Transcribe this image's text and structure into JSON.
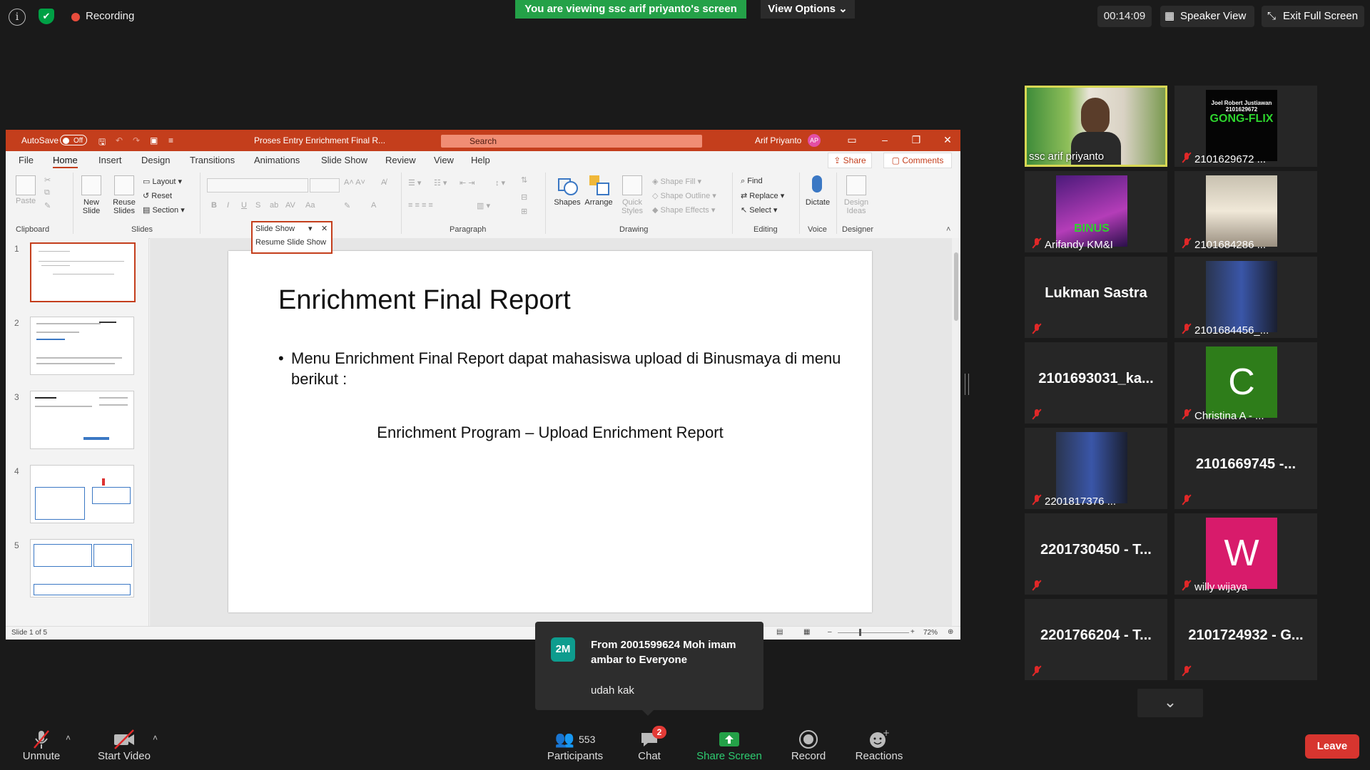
{
  "topbar": {
    "recording_label": "Recording",
    "viewing_banner": "You are viewing ssc arif priyanto's screen",
    "view_options": "View Options",
    "timer": "00:14:09",
    "speaker_view": "Speaker View",
    "exit_full_screen": "Exit Full Screen"
  },
  "ppt": {
    "autosave_label": "AutoSave",
    "autosave_state": "Off",
    "doc_title": "Proses Entry Enrichment Final R...",
    "search_placeholder": "Search",
    "user_name": "Arif Priyanto",
    "user_initials": "AP",
    "menu": [
      "File",
      "Home",
      "Insert",
      "Design",
      "Transitions",
      "Animations",
      "Slide Show",
      "Review",
      "View",
      "Help"
    ],
    "share_label": "Share",
    "comments_label": "Comments",
    "ribbon": {
      "clipboard": {
        "label": "Clipboard",
        "paste": "Paste"
      },
      "slides": {
        "label": "Slides",
        "new_slide": "New Slide",
        "reuse_slides": "Reuse Slides",
        "layout": "Layout",
        "reset": "Reset",
        "section": "Section"
      },
      "paragraph": {
        "label": "Paragraph"
      },
      "drawing": {
        "label": "Drawing",
        "shapes": "Shapes",
        "arrange": "Arrange",
        "quick_styles": "Quick Styles",
        "shape_fill": "Shape Fill",
        "shape_outline": "Shape Outline",
        "shape_effects": "Shape Effects"
      },
      "editing": {
        "label": "Editing",
        "find": "Find",
        "replace": "Replace",
        "select": "Select"
      },
      "voice": {
        "label": "Voice",
        "dictate": "Dictate"
      },
      "designer": {
        "label": "Designer",
        "design_ideas": "Design Ideas"
      }
    },
    "slideshow_popup": {
      "title": "Slide Show",
      "resume": "Resume Slide Show"
    },
    "thumbnails": [
      "1",
      "2",
      "3",
      "4",
      "5"
    ],
    "slide": {
      "title": "Enrichment Final Report",
      "bullet": "Menu Enrichment Final Report dapat mahasiswa upload di Binusmaya di menu berikut :",
      "subtitle": "Enrichment Program – Upload Enrichment Report"
    },
    "status": {
      "slide_info": "Slide 1 of 5",
      "zoom": "72%"
    }
  },
  "gallery": [
    {
      "name": "ssc arif priyanto",
      "kind": "video",
      "active": true
    },
    {
      "name": "2101629672 ...",
      "kind": "image",
      "image_text": [
        "Joel Robert Justiawan",
        "2101629672",
        "GONG-FLIX"
      ]
    },
    {
      "name": "Arifandy KM&I",
      "kind": "image",
      "image_text": [
        "BINUS"
      ]
    },
    {
      "name": "2101684286 ...",
      "kind": "photo"
    },
    {
      "name": "Lukman Sastra",
      "kind": "name"
    },
    {
      "name": "2101684456_...",
      "kind": "photo"
    },
    {
      "name": "2101693031_ka...",
      "kind": "name"
    },
    {
      "name": "Christina A - ...",
      "kind": "letter",
      "letter": "C",
      "color": "#2e7d1a"
    },
    {
      "name": "2201817376 ...",
      "kind": "photo"
    },
    {
      "name": "2101669745  -...",
      "kind": "name"
    },
    {
      "name": "2201730450 - T...",
      "kind": "name"
    },
    {
      "name": "willy wijaya",
      "kind": "letter",
      "letter": "W",
      "color": "#d81b6b"
    },
    {
      "name": "2201766204 - T...",
      "kind": "name"
    },
    {
      "name": "2101724932 - G...",
      "kind": "name"
    }
  ],
  "chat_toast": {
    "avatar": "2M",
    "from": "From 2001599624 Moh imam ambar to Everyone",
    "message": "udah kak"
  },
  "toolbar": {
    "unmute": "Unmute",
    "start_video": "Start Video",
    "participants": "Participants",
    "participants_count": "553",
    "chat": "Chat",
    "chat_badge": "2",
    "share_screen": "Share Screen",
    "record": "Record",
    "reactions": "Reactions",
    "leave": "Leave"
  },
  "colors": {
    "ppt_accent": "#c43e1c",
    "zoom_green": "#24a148",
    "leave_red": "#d7352f",
    "active_speaker": "#d7d754"
  }
}
